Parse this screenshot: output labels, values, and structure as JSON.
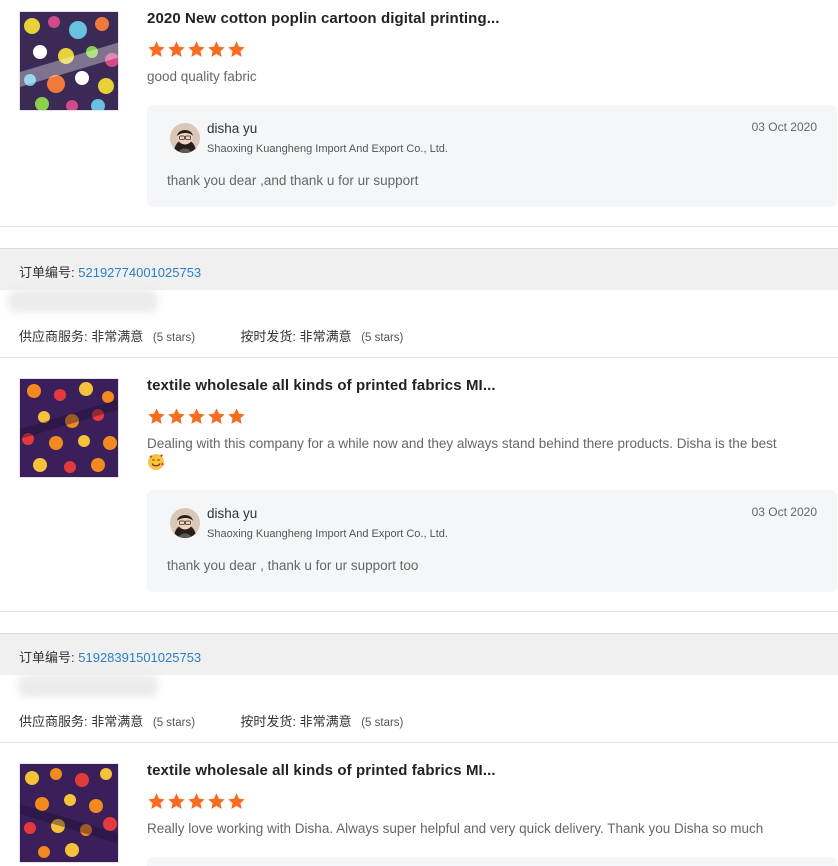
{
  "colors": {
    "star": "#f56d22",
    "order_link": "#2a7fc9",
    "reply_bg": "#f4f6f8",
    "order_bar_bg": "#f0f0f0"
  },
  "reviews": [
    {
      "title": "2020 New cotton poplin cartoon digital printing...",
      "rating": 5,
      "comment": "good quality fabric",
      "reply": {
        "name": "disha yu",
        "company": "Shaoxing Kuangheng Import And Export Co., Ltd.",
        "date": "03 Oct 2020",
        "text": "thank you dear ,and thank u for ur support"
      }
    },
    {
      "order_label": "订单编号:",
      "order_number": "52192774001025753",
      "supplier_service_label": "供应商服务:",
      "supplier_service_value": "非常满意",
      "supplier_service_stars": "(5 stars)",
      "shipping_label": "按时发货:",
      "shipping_value": "非常满意",
      "shipping_stars": "(5 stars)",
      "title": "textile wholesale all kinds of printed fabrics MI...",
      "rating": 5,
      "comment": "Dealing with this company for a while now and they always stand behind there products. Disha is the best",
      "emoji": "smiling-face-with-hearts",
      "reply": {
        "name": "disha yu",
        "company": "Shaoxing Kuangheng Import And Export Co., Ltd.",
        "date": "03 Oct 2020",
        "text": "thank you dear , thank u for ur support too"
      }
    },
    {
      "order_label": "订单编号:",
      "order_number": "51928391501025753",
      "supplier_service_label": "供应商服务:",
      "supplier_service_value": "非常满意",
      "supplier_service_stars": "(5 stars)",
      "shipping_label": "按时发货:",
      "shipping_value": "非常满意",
      "shipping_stars": "(5 stars)",
      "title": "textile wholesale all kinds of printed fabrics MI...",
      "rating": 5,
      "comment": "Really love working with Disha. Always super helpful and very quick delivery. Thank you Disha so much"
    }
  ]
}
